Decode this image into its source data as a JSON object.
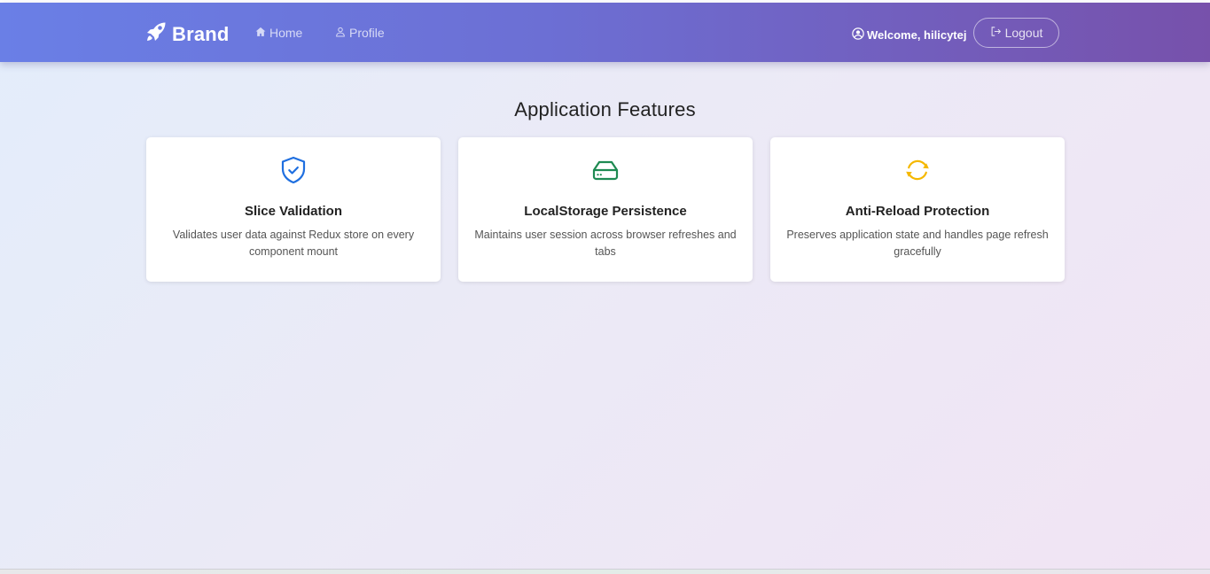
{
  "navbar": {
    "brand": "Brand",
    "brand_icon": "rocket-icon",
    "links": [
      {
        "label": "Home",
        "icon": "house-icon"
      },
      {
        "label": "Profile",
        "icon": "person-icon"
      }
    ],
    "welcome": "Welcome, hilicytej",
    "welcome_icon": "user-circle-icon",
    "logout_label": "Logout",
    "logout_icon": "logout-icon",
    "gradient_colors": [
      "#6a7fe6",
      "#7751ab"
    ]
  },
  "main": {
    "title": "Application Features",
    "cards": [
      {
        "title": "Slice Validation",
        "description": "Validates user data against Redux store on every component mount",
        "icon": "shield-check-icon",
        "icon_color": "#1f6fe0"
      },
      {
        "title": "LocalStorage Persistence",
        "description": "Maintains user session across browser refreshes and tabs",
        "icon": "hard-drive-icon",
        "icon_color": "#1e8a52"
      },
      {
        "title": "Anti-Reload Protection",
        "description": "Preserves application state and handles page refresh gracefully",
        "icon": "refresh-icon",
        "icon_color": "#f5b800"
      }
    ]
  }
}
